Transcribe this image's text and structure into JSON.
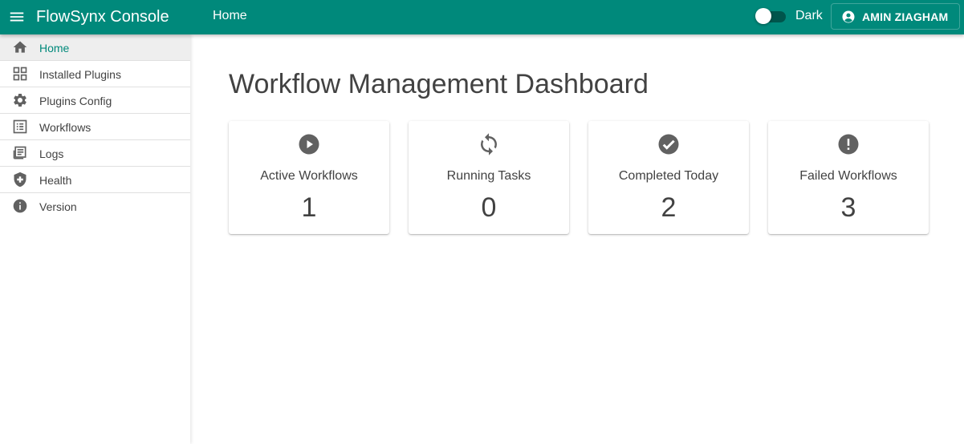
{
  "appbar": {
    "app_title": "FlowSynx Console",
    "page_name": "Home",
    "dark_label": "Dark",
    "dark_mode": false,
    "user_label": "AMIN ZIAGHAM",
    "color": "#00897b"
  },
  "sidebar": {
    "items": [
      {
        "label": "Home",
        "icon": "home-icon",
        "active": true
      },
      {
        "label": "Installed Plugins",
        "icon": "grid-icon",
        "active": false
      },
      {
        "label": "Plugins Config",
        "icon": "gear-icon",
        "active": false
      },
      {
        "label": "Workflows",
        "icon": "list-icon",
        "active": false
      },
      {
        "label": "Logs",
        "icon": "log-icon",
        "active": false
      },
      {
        "label": "Health",
        "icon": "shield-plus-icon",
        "active": false
      },
      {
        "label": "Version",
        "icon": "info-icon",
        "active": false
      }
    ]
  },
  "dashboard": {
    "title": "Workflow Management Dashboard",
    "cards": [
      {
        "label": "Active Workflows",
        "value": "1",
        "icon": "play-circle-icon"
      },
      {
        "label": "Running Tasks",
        "value": "0",
        "icon": "sync-icon"
      },
      {
        "label": "Completed Today",
        "value": "2",
        "icon": "check-circle-icon"
      },
      {
        "label": "Failed Workflows",
        "value": "3",
        "icon": "alert-circle-icon"
      }
    ]
  }
}
